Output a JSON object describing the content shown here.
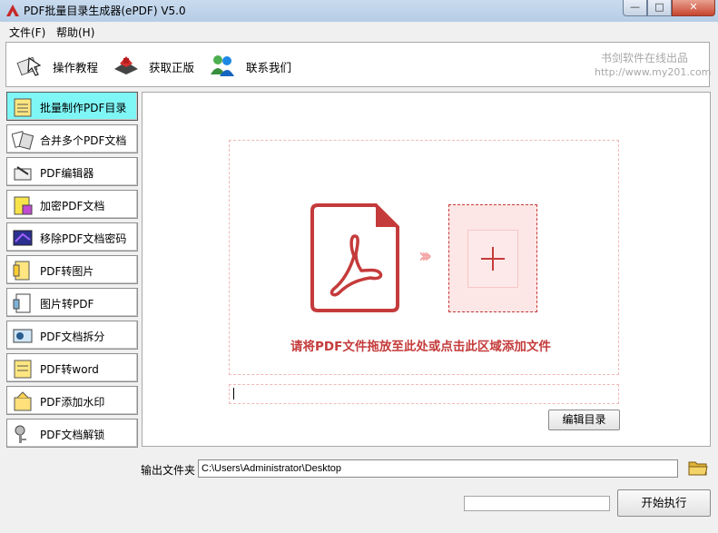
{
  "window": {
    "title": "PDF批量目录生成器(ePDF) V5.0",
    "min_glyph": "—",
    "max_glyph": "□",
    "close_glyph": "✕"
  },
  "menu": {
    "items": [
      {
        "label": "文件(F)"
      },
      {
        "label": "帮助(H)"
      }
    ]
  },
  "toolbar": {
    "items": [
      {
        "label": "操作教程",
        "icon": "tutorial-icon"
      },
      {
        "label": "获取正版",
        "icon": "genuine-icon"
      },
      {
        "label": "联系我们",
        "icon": "contact-icon"
      }
    ],
    "brand_line1": "书剑软件在线出品",
    "brand_line2": "http://www.my201.com"
  },
  "sidebar": {
    "active_index": 0,
    "items": [
      {
        "label": "批量制作PDF目录",
        "icon": "notepad-icon"
      },
      {
        "label": "合并多个PDF文档",
        "icon": "merge-docs-icon"
      },
      {
        "label": "PDF编辑器",
        "icon": "editor-icon"
      },
      {
        "label": "加密PDF文档",
        "icon": "encrypt-icon"
      },
      {
        "label": "移除PDF文档密码",
        "icon": "remove-password-icon"
      },
      {
        "label": "PDF转图片",
        "icon": "pdf-to-image-icon"
      },
      {
        "label": "图片转PDF",
        "icon": "image-to-pdf-icon"
      },
      {
        "label": "PDF文档拆分",
        "icon": "split-icon"
      },
      {
        "label": "PDF转word",
        "icon": "pdf-to-word-icon"
      },
      {
        "label": "PDF添加水印",
        "icon": "watermark-icon"
      },
      {
        "label": "PDF文档解锁",
        "icon": "unlock-icon"
      }
    ]
  },
  "main": {
    "drop_hint": "请将PDF文件拖放至此处或点击此区域添加文件",
    "arrows": "›››",
    "edit_toc_label": "编辑目录"
  },
  "footer": {
    "output_label": "输出文件夹",
    "output_path": "C:\\Users\\Administrator\\Desktop",
    "progress": 0,
    "start_label": "开始执行"
  },
  "colors": {
    "accent_red": "#c53b3b",
    "active_tab": "#7ff6f6",
    "progress_green": "#37b34a"
  }
}
